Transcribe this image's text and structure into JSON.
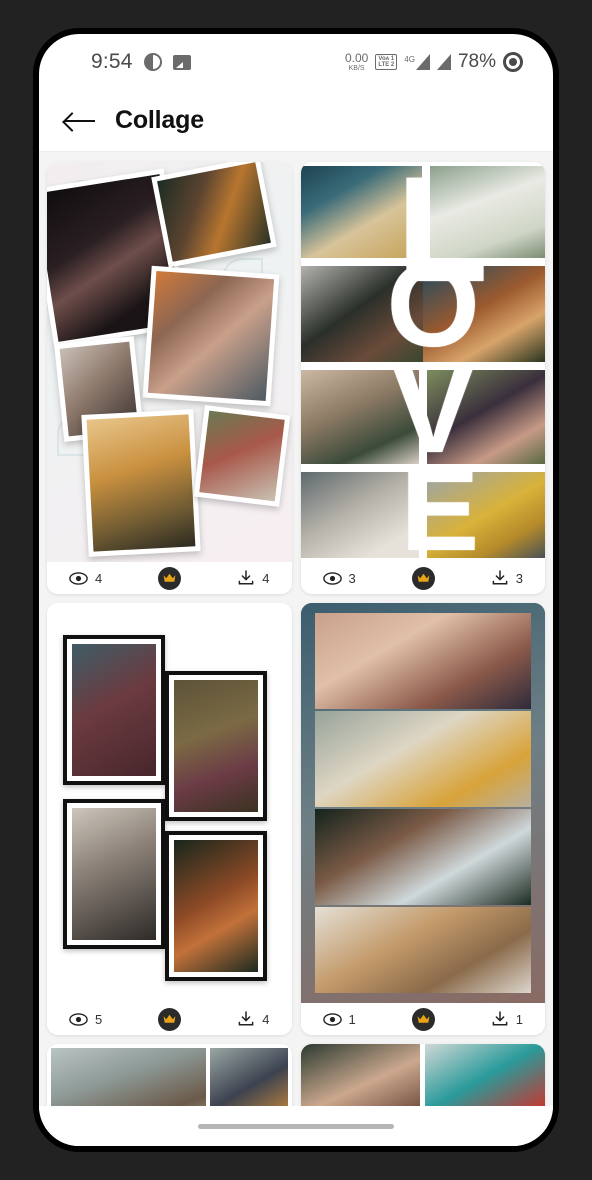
{
  "status_bar": {
    "time": "9:54",
    "left_icons": [
      "contrast-circle-icon",
      "gallery-icon"
    ],
    "net_speed_value": "0.00",
    "net_speed_unit": "KB/S",
    "volte_top": "Voᴀ 1",
    "volte_bottom": "LTE 2",
    "network_type": "4G",
    "battery_percent": "78%",
    "right_icons": [
      "volte-icon",
      "signal-4g-icon",
      "signal-icon",
      "screen-record-icon"
    ]
  },
  "app_bar": {
    "back_label": "back-arrow",
    "title": "Collage"
  },
  "gallery": {
    "cards": [
      {
        "id": "collage-scattered-polaroids",
        "views": "4",
        "downloads": "4",
        "premium": true,
        "premium_icon": "crown-icon",
        "view_icon": "eye-icon",
        "download_icon": "download-icon"
      },
      {
        "id": "collage-love-text",
        "views": "3",
        "downloads": "3",
        "premium": true,
        "premium_icon": "crown-icon",
        "view_icon": "eye-icon",
        "download_icon": "download-icon",
        "letters": [
          "L",
          "O",
          "V",
          "E"
        ]
      },
      {
        "id": "collage-black-frames",
        "views": "5",
        "downloads": "4",
        "premium": true,
        "premium_icon": "crown-icon",
        "view_icon": "eye-icon",
        "download_icon": "download-icon"
      },
      {
        "id": "collage-stacked-strips",
        "views": "1",
        "downloads": "1",
        "premium": true,
        "premium_icon": "crown-icon",
        "view_icon": "eye-icon",
        "download_icon": "download-icon"
      },
      {
        "id": "collage-couple-panorama",
        "views": "",
        "downloads": "",
        "premium": true
      },
      {
        "id": "collage-duo-portraits",
        "views": "",
        "downloads": "",
        "premium": true
      }
    ]
  },
  "navigation": {
    "gesture_pill": "home-gesture-bar"
  },
  "colors": {
    "accent_crown": "#e8a317",
    "badge_bg": "#2b2b2b",
    "page_bg": "#f4f4f4",
    "card_bg": "#ffffff",
    "text_primary": "#111111",
    "frame_bezel": "#000000",
    "outer_bg": "#222222"
  }
}
